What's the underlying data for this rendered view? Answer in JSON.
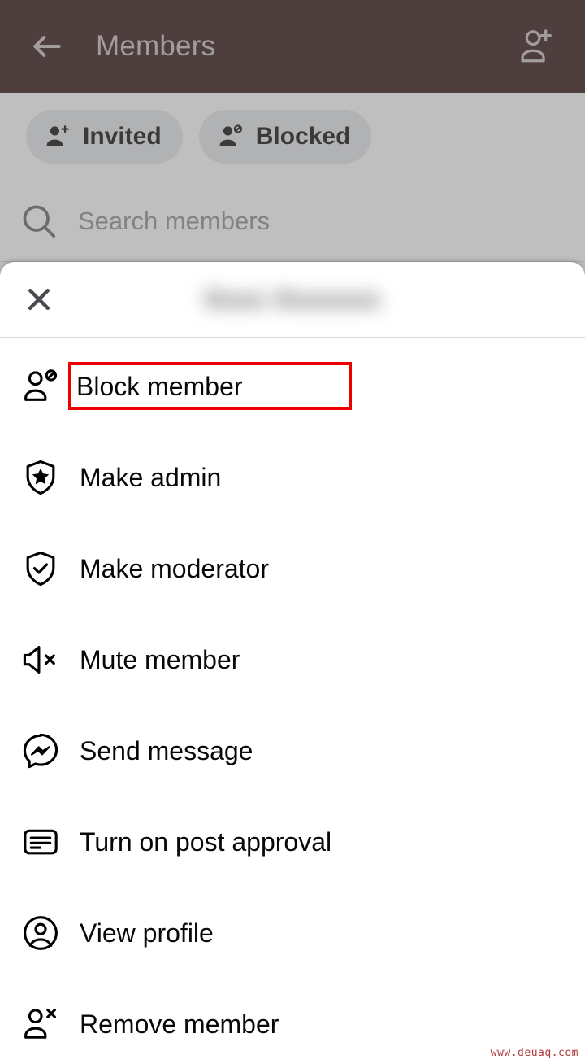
{
  "header": {
    "title": "Members",
    "back_icon": "arrow-left-icon",
    "add_member_icon": "person-add-icon"
  },
  "filters": {
    "chips": [
      {
        "label": "Invited",
        "icon": "person-add-icon"
      },
      {
        "label": "Blocked",
        "icon": "person-blocked-icon"
      }
    ]
  },
  "search": {
    "placeholder": "Search members",
    "value": "",
    "icon": "search-icon"
  },
  "sheet": {
    "close_icon": "close-icon",
    "title": "Xxxx Xxxxxxx",
    "title_redacted": true,
    "actions": [
      {
        "label": "Block member",
        "icon": "person-blocked-icon",
        "highlighted": true
      },
      {
        "label": "Make admin",
        "icon": "shield-star-icon",
        "highlighted": false
      },
      {
        "label": "Make moderator",
        "icon": "shield-check-icon",
        "highlighted": false
      },
      {
        "label": "Mute member",
        "icon": "speaker-mute-icon",
        "highlighted": false
      },
      {
        "label": "Send message",
        "icon": "messenger-icon",
        "highlighted": false
      },
      {
        "label": "Turn on post approval",
        "icon": "post-approval-icon",
        "highlighted": false
      },
      {
        "label": "View profile",
        "icon": "profile-circle-icon",
        "highlighted": false
      },
      {
        "label": "Remove member",
        "icon": "person-remove-icon",
        "highlighted": false
      }
    ]
  },
  "watermark": {
    "text": "www.deuaq.com"
  },
  "colors": {
    "header_bg": "#2d0c0d",
    "header_text": "#c9bfbf",
    "scrim": "#b3b3b3",
    "sheet_bg": "#ffffff",
    "highlight_border": "#ee0000",
    "label_text": "#080809",
    "placeholder_text": "#8a8d91"
  }
}
